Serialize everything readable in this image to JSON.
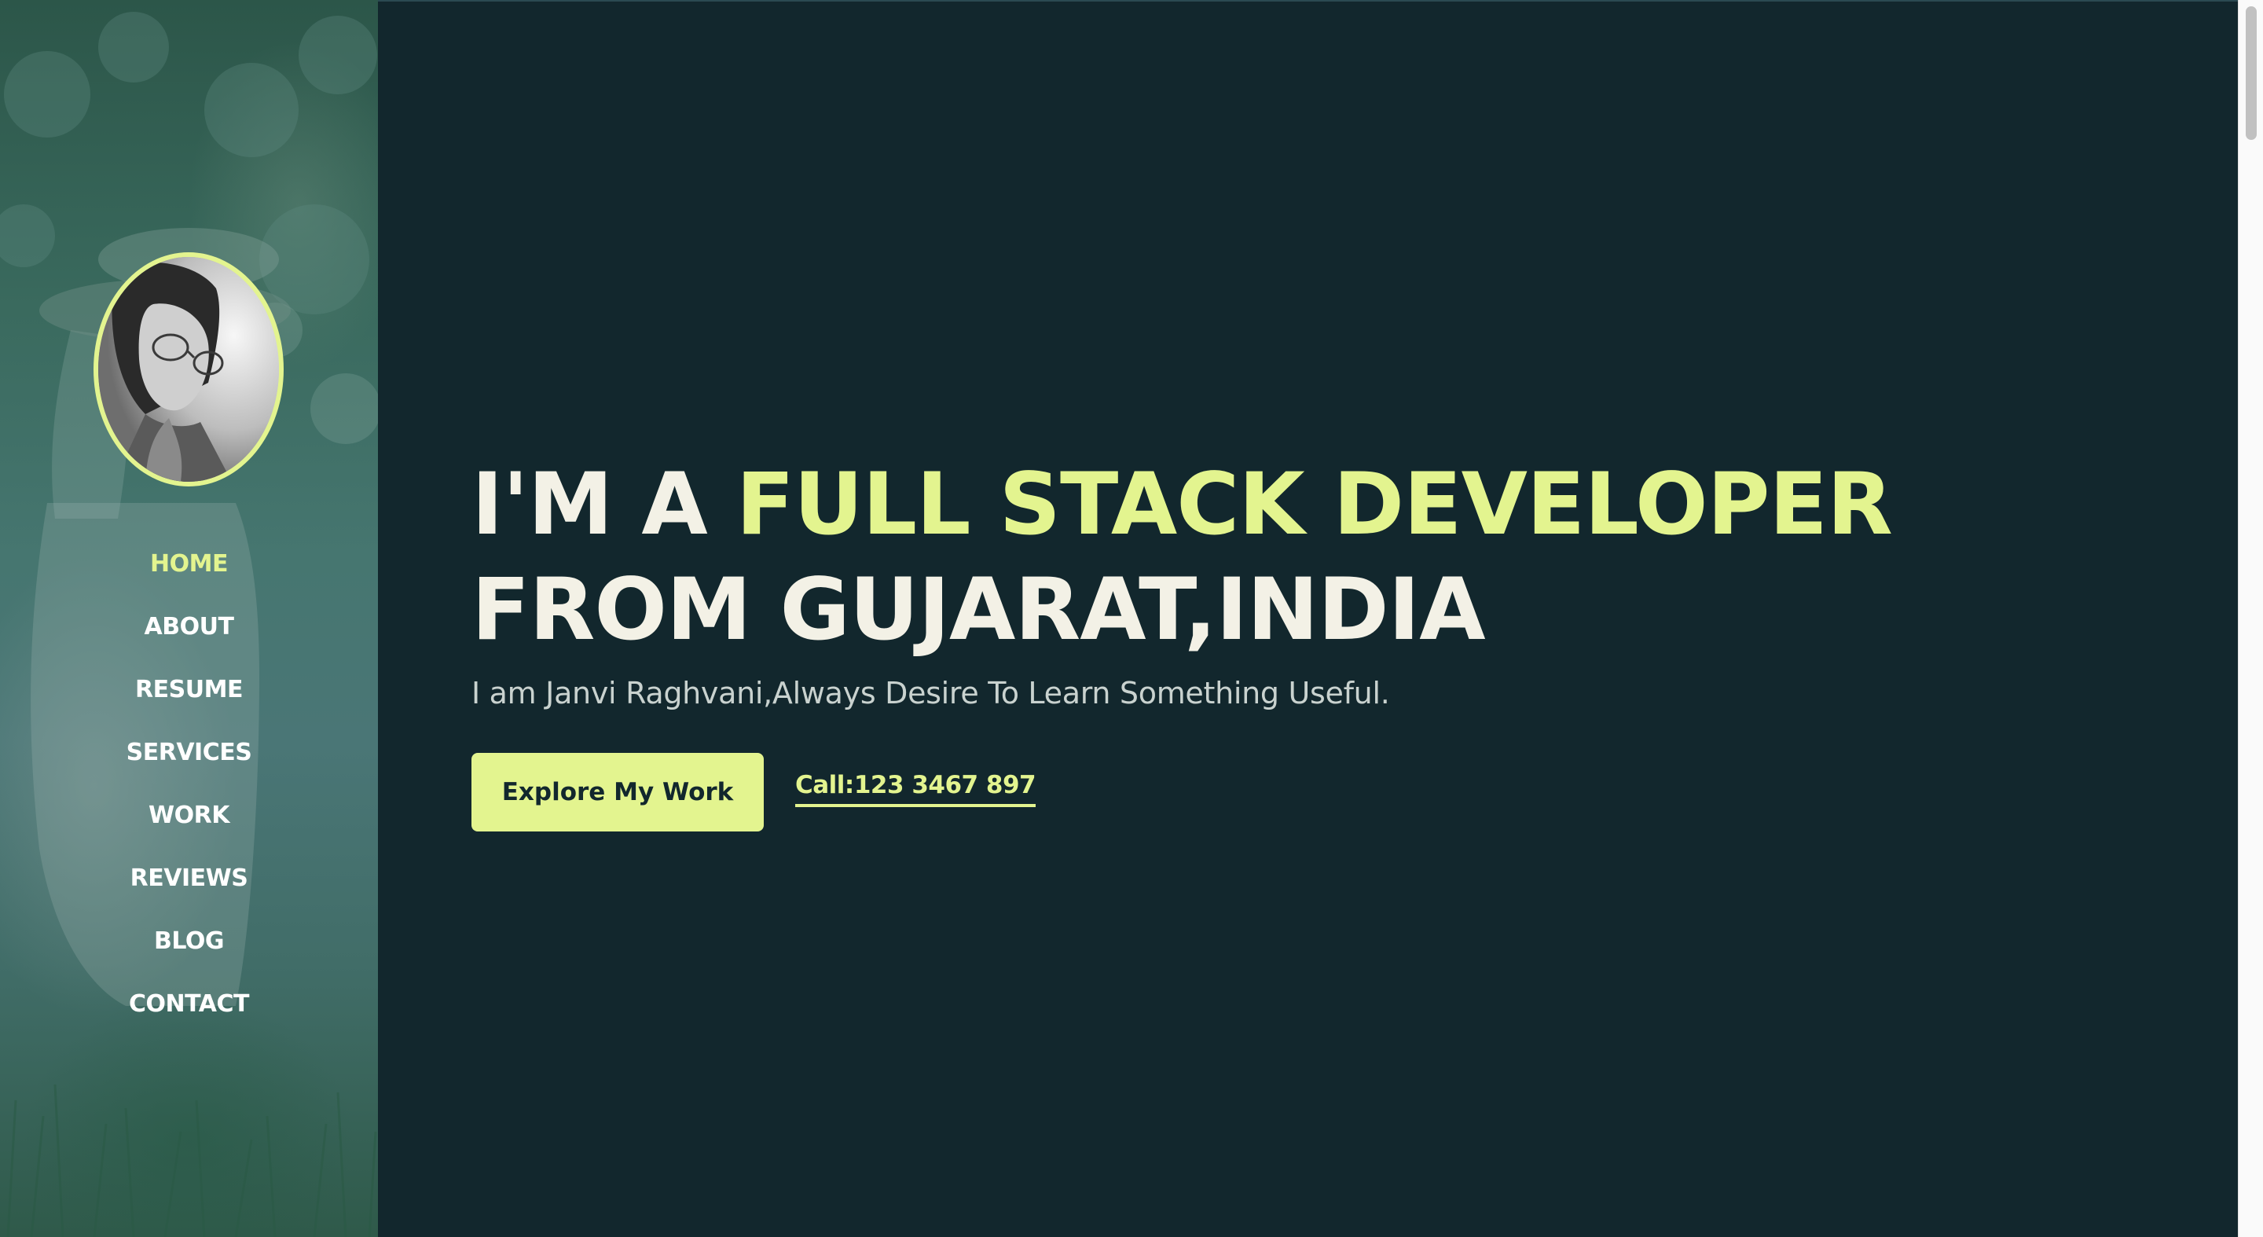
{
  "colors": {
    "background": "#12272d",
    "accent": "#e3f48f",
    "heading_text": "#f3f1e6",
    "subtitle_text": "#c9d2cf",
    "nav_text": "#ffffff"
  },
  "sidebar": {
    "avatar_icon": "profile-photo",
    "nav": [
      {
        "label": "HOME",
        "active": true
      },
      {
        "label": "ABOUT",
        "active": false
      },
      {
        "label": "RESUME",
        "active": false
      },
      {
        "label": "SERVICES",
        "active": false
      },
      {
        "label": "WORK",
        "active": false
      },
      {
        "label": "REVIEWS",
        "active": false
      },
      {
        "label": "BLOG",
        "active": false
      },
      {
        "label": "CONTACT",
        "active": false
      }
    ]
  },
  "hero": {
    "title_prefix": "I'M A ",
    "title_accent": "FULL STACK DEVELOPER",
    "title_line2": "FROM GUJARAT,INDIA",
    "subtitle": "I am Janvi Raghvani,Always Desire To Learn Something Useful.",
    "primary_button": "Explore My Work",
    "call_link": "Call:123 3467 897"
  }
}
